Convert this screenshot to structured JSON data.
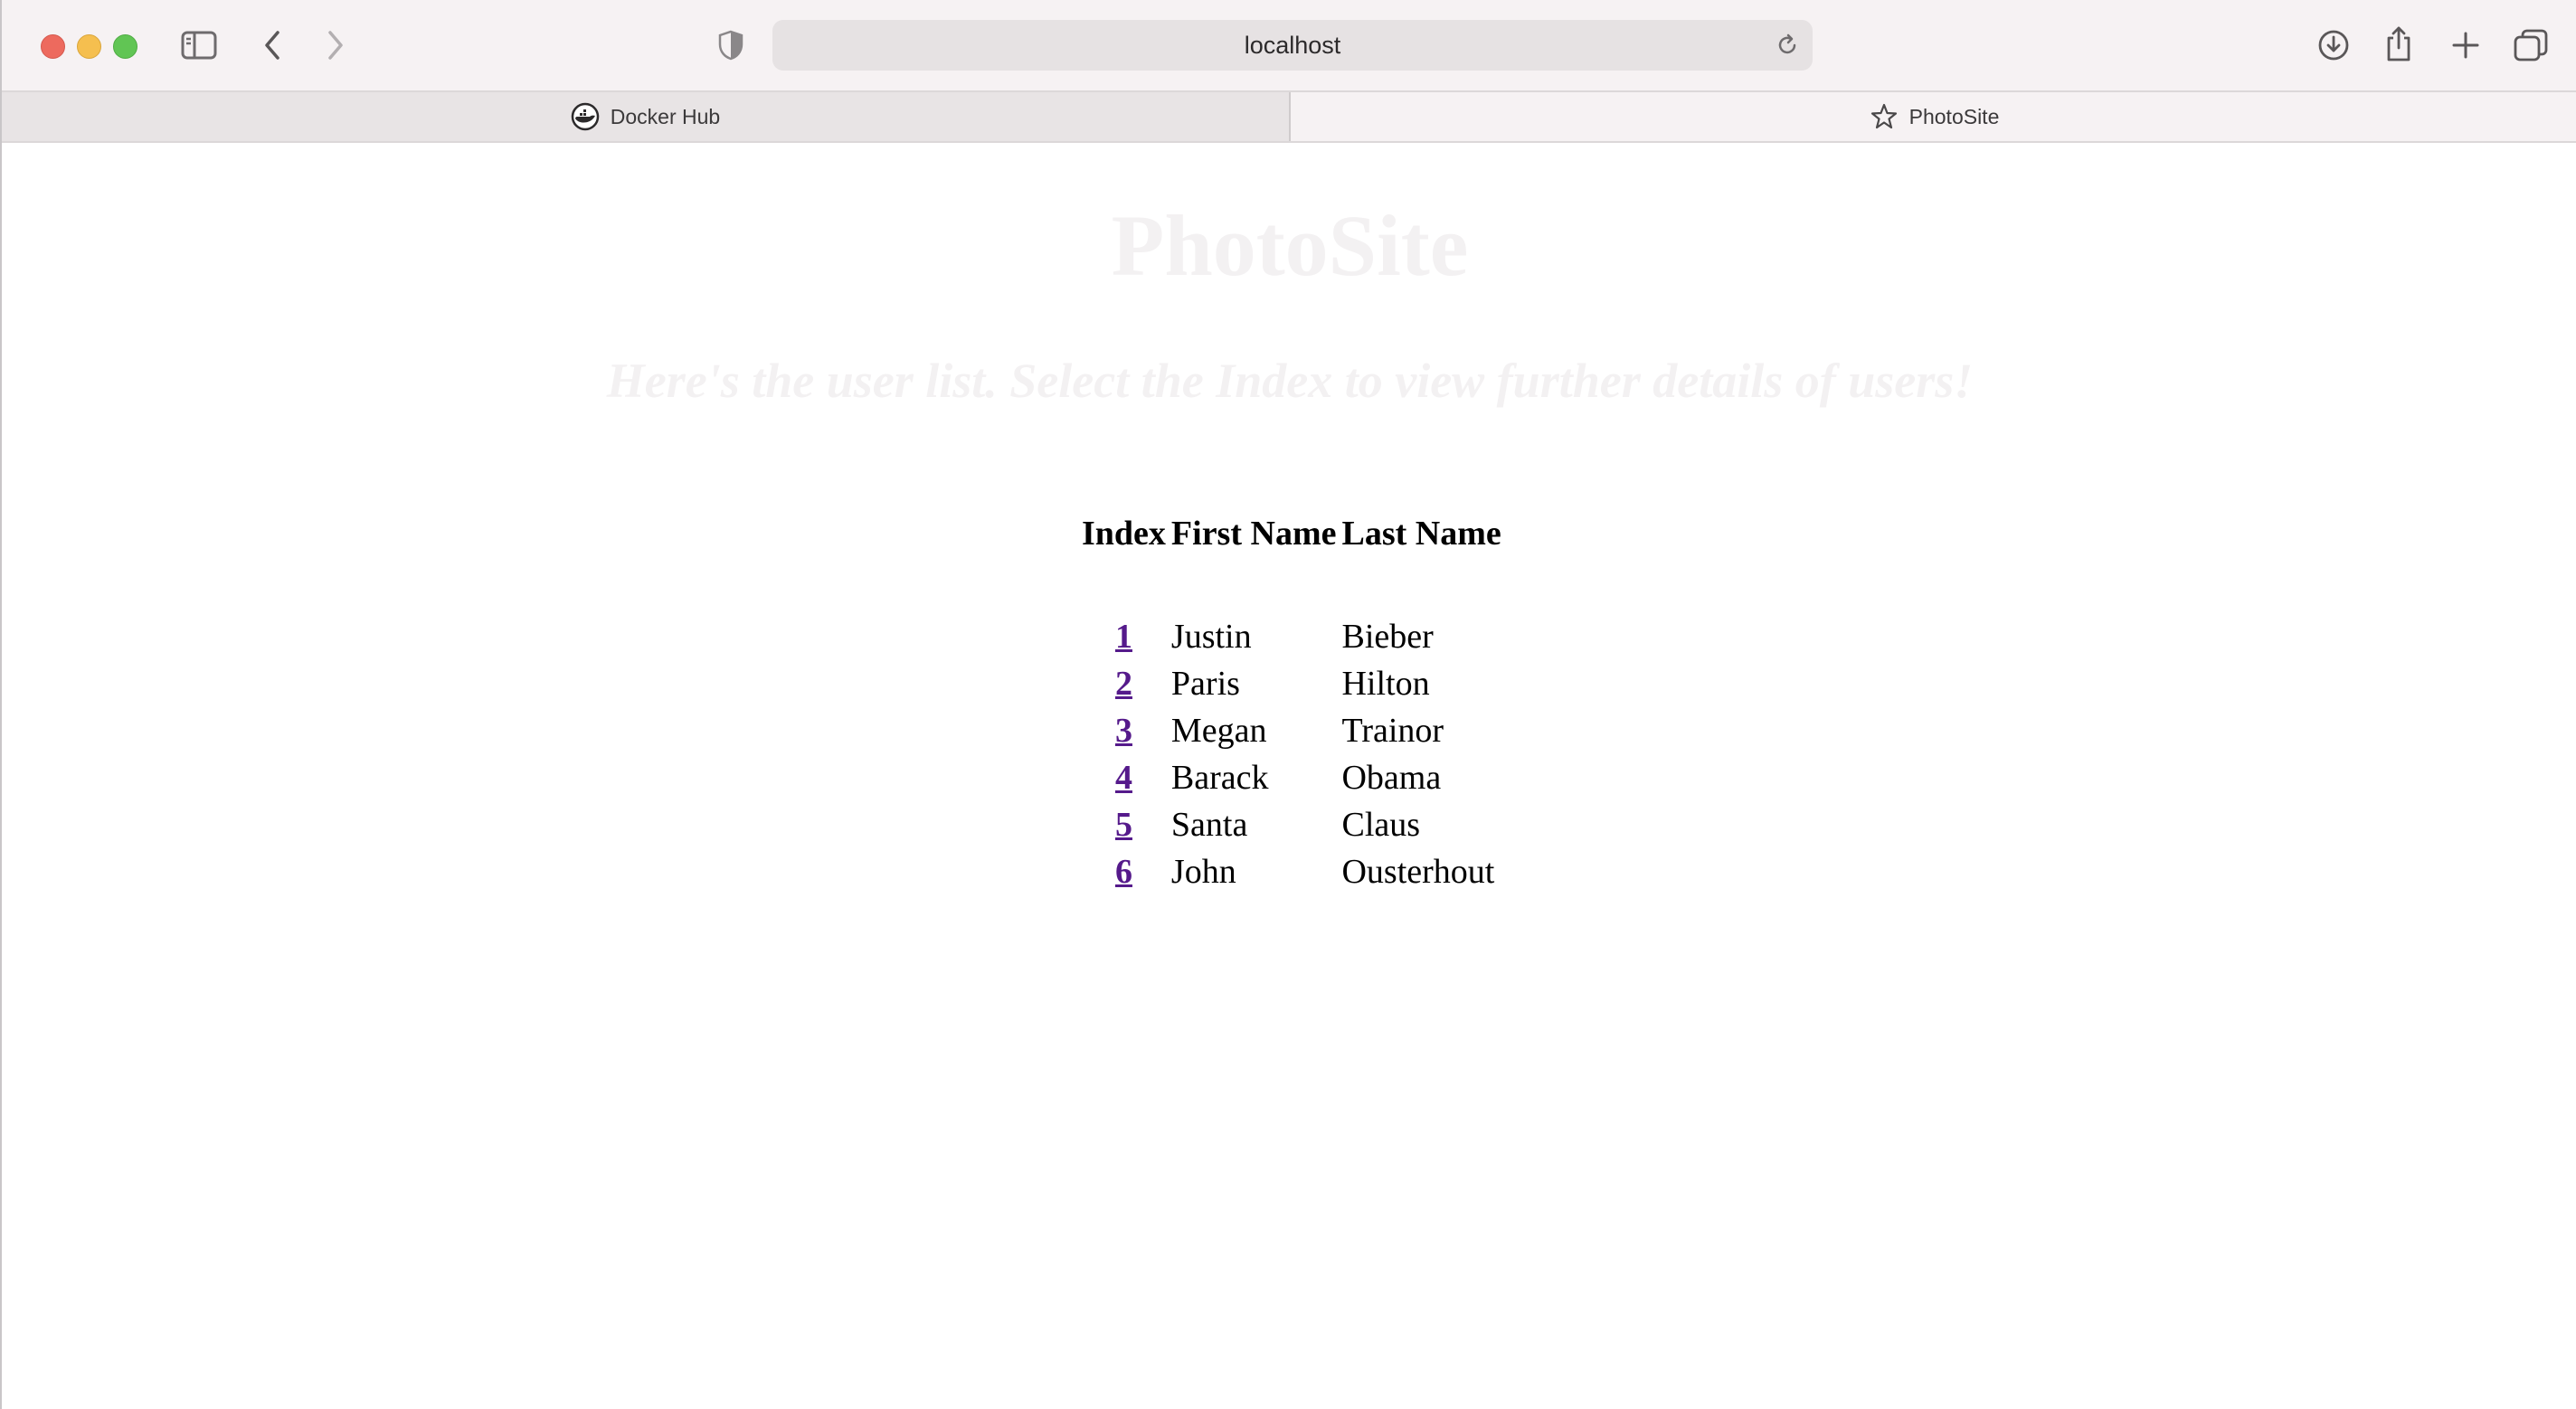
{
  "browser": {
    "url": "localhost",
    "tabs": [
      {
        "label": "Docker Hub",
        "icon": "docker-icon",
        "active": false
      },
      {
        "label": "PhotoSite",
        "icon": "star-icon",
        "active": true
      }
    ]
  },
  "page": {
    "title": "PhotoSite",
    "subtitle": "Here's the user list. Select the Index to view further details of users!",
    "table": {
      "headers": [
        "Index",
        "First Name",
        "Last Name"
      ],
      "rows": [
        {
          "index": "1",
          "first": "Justin",
          "last": "Bieber"
        },
        {
          "index": "2",
          "first": "Paris",
          "last": "Hilton"
        },
        {
          "index": "3",
          "first": "Megan",
          "last": "Trainor"
        },
        {
          "index": "4",
          "first": "Barack",
          "last": "Obama"
        },
        {
          "index": "5",
          "first": "Santa",
          "last": "Claus"
        },
        {
          "index": "6",
          "first": "John",
          "last": "Ousterhout"
        }
      ]
    }
  },
  "colors": {
    "link": "#551a8b",
    "title_faded": "#f3f1f2",
    "chrome_bg": "#f6f2f3"
  }
}
